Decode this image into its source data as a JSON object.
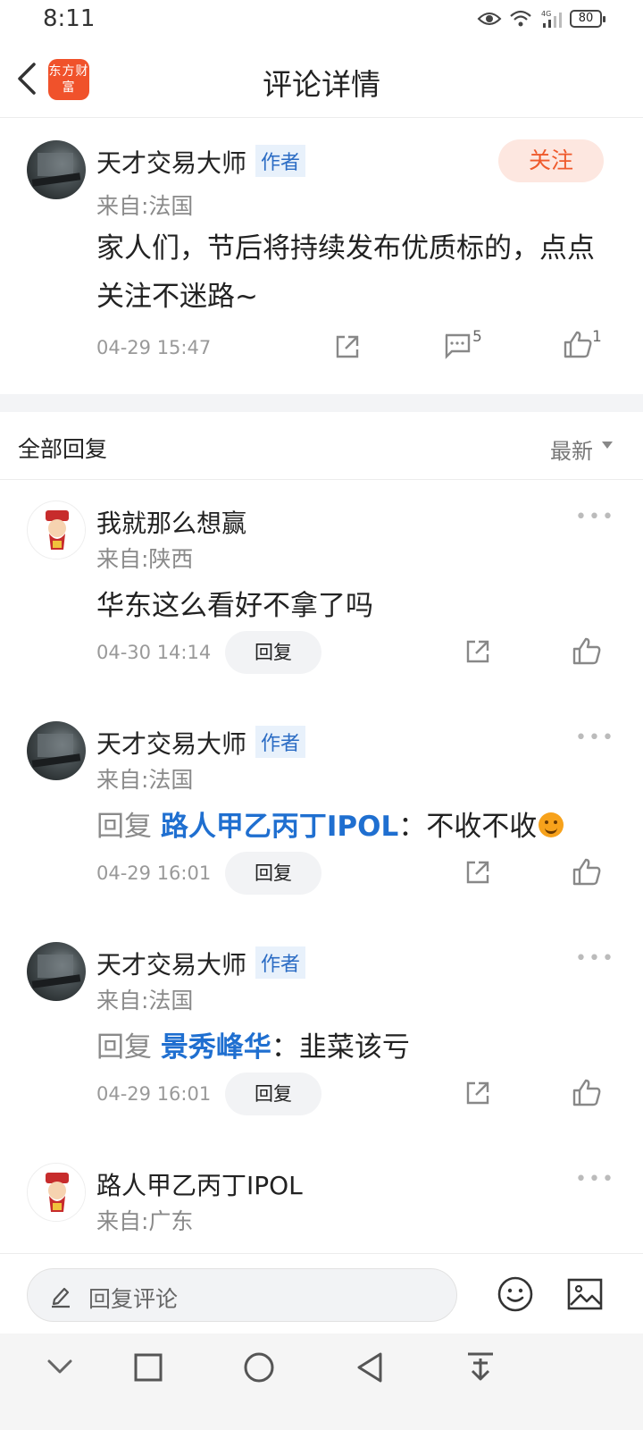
{
  "status_bar": {
    "time": "8:11",
    "battery": "80",
    "network": "4G"
  },
  "header": {
    "title": "评论详情",
    "logo_text": "东方财富"
  },
  "post": {
    "author": "天才交易大师",
    "author_tag": "作者",
    "location": "来自:法国",
    "follow_label": "关注",
    "content": "家人们，节后将持续发布优质标的，点点关注不迷路~",
    "time": "04-29 15:47",
    "comment_count": "5",
    "like_count": "1"
  },
  "replies": {
    "title": "全部回复",
    "sort_label": "最新",
    "items": [
      {
        "author": "我就那么想赢",
        "location": "来自:陕西",
        "text": "华东这么看好不拿了吗",
        "time": "04-30 14:14",
        "reply_label": "回复"
      },
      {
        "author": "天才交易大师",
        "author_tag": "作者",
        "location": "来自:法国",
        "reply_prefix": "回复",
        "reply_target": "路人甲乙丙丁IPOL",
        "text": "：不收不收",
        "time": "04-29 16:01",
        "reply_label": "回复"
      },
      {
        "author": "天才交易大师",
        "author_tag": "作者",
        "location": "来自:法国",
        "reply_prefix": "回复",
        "reply_target": "景秀峰华",
        "text": "：韭菜该亏",
        "time": "04-29 16:01",
        "reply_label": "回复"
      },
      {
        "author": "路人甲乙丙丁IPOL",
        "location": "来自:广东"
      }
    ]
  },
  "input_bar": {
    "placeholder": "回复评论"
  },
  "colors": {
    "brand": "#f0522b",
    "link": "#1f6fd0",
    "follow_bg": "#fde7e0"
  }
}
